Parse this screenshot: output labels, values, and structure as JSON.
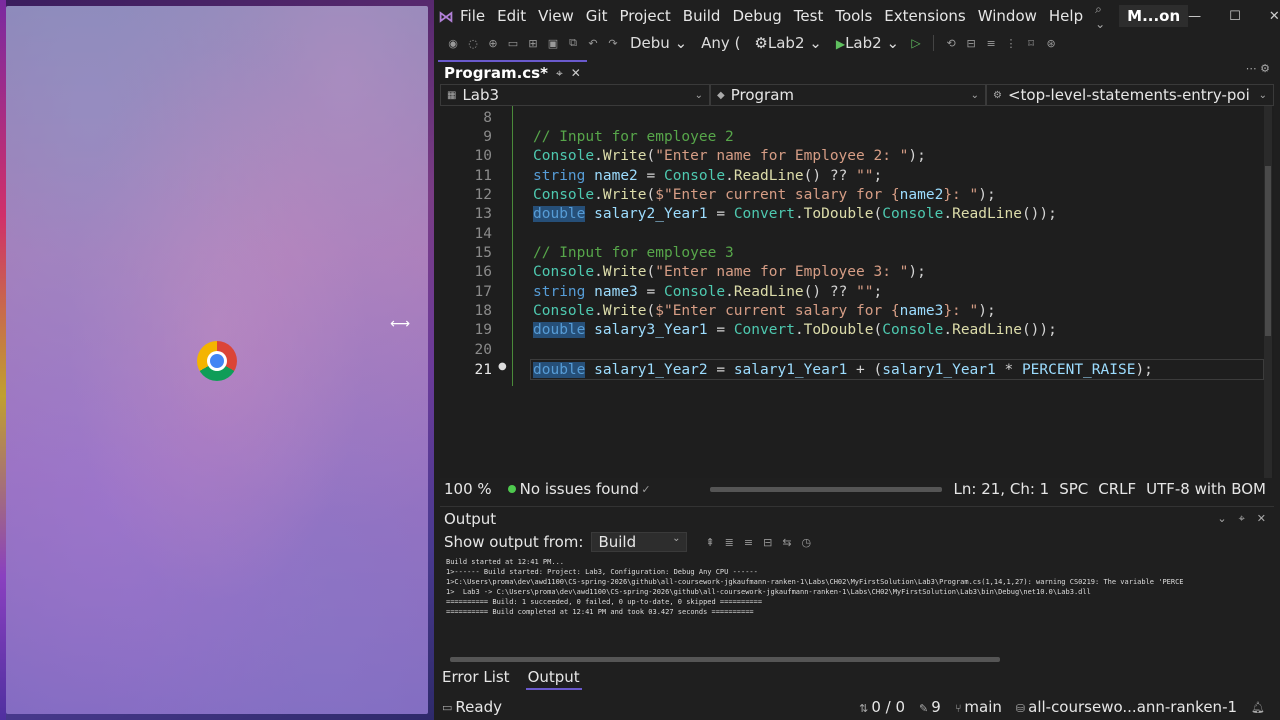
{
  "menubar": {
    "items": [
      "File",
      "Edit",
      "View",
      "Git",
      "Project",
      "Build",
      "Debug",
      "Test",
      "Tools",
      "Extensions",
      "Window",
      "Help"
    ],
    "solution": "M...on"
  },
  "toolbar": {
    "config": "Debu",
    "platform": "Any (",
    "startup_project": "Lab2",
    "run_target": "Lab2"
  },
  "tabs": {
    "active": "Program.cs*"
  },
  "navbar": {
    "project": "Lab3",
    "type": "Program",
    "member": "<top-level-statements-entry-poi"
  },
  "editor": {
    "lines": [
      {
        "n": "8"
      },
      {
        "n": "9"
      },
      {
        "n": "10"
      },
      {
        "n": "11"
      },
      {
        "n": "12"
      },
      {
        "n": "13"
      },
      {
        "n": "14"
      },
      {
        "n": "15"
      },
      {
        "n": "16"
      },
      {
        "n": "17"
      },
      {
        "n": "18"
      },
      {
        "n": "19"
      },
      {
        "n": "20"
      },
      {
        "n": "21"
      }
    ],
    "code": {
      "l9": "// Input for employee 2",
      "l10_a": "Console",
      "l10_b": "Write",
      "l10_s": "\"Enter name for Employee 2: \"",
      "l11_k": "string",
      "l11_v": "name2",
      "l11_a": "Console",
      "l11_b": "ReadLine",
      "l11_s": "\"\"",
      "l12_a": "Console",
      "l12_b": "Write",
      "l12_s1": "$\"Enter current salary for {",
      "l12_v": "name2",
      "l12_s2": "}: \"",
      "l13_k": "double",
      "l13_v": "salary2_Year1",
      "l13_a": "Convert",
      "l13_b": "ToDouble",
      "l13_c": "Console",
      "l13_d": "ReadLine",
      "l15": "// Input for employee 3",
      "l16_a": "Console",
      "l16_b": "Write",
      "l16_s": "\"Enter name for Employee 3: \"",
      "l17_k": "string",
      "l17_v": "name3",
      "l17_a": "Console",
      "l17_b": "ReadLine",
      "l17_s": "\"\"",
      "l18_a": "Console",
      "l18_b": "Write",
      "l18_s1": "$\"Enter current salary for {",
      "l18_v": "name3",
      "l18_s2": "}: \"",
      "l19_k": "double",
      "l19_v": "salary3_Year1",
      "l19_a": "Convert",
      "l19_b": "ToDouble",
      "l19_c": "Console",
      "l19_d": "ReadLine",
      "l21_k": "double",
      "l21_v": "salary1_Year2",
      "l21_a": "salary1_Year1",
      "l21_b": "salary1_Year1",
      "l21_c": "PERCENT_RAISE"
    }
  },
  "status_line": {
    "zoom": "100 %",
    "issues": "No issues found",
    "position": "Ln: 21, Ch: 1",
    "whitespace": "SPC",
    "line_endings": "CRLF",
    "encoding": "UTF-8 with BOM"
  },
  "output": {
    "title": "Output",
    "show_from_label": "Show output from:",
    "source": "Build",
    "text": "Build started at 12:41 PM...\n1>------ Build started: Project: Lab3, Configuration: Debug Any CPU ------\n1>C:\\Users\\proma\\dev\\awd1100\\CS-spring-2026\\github\\all-coursework-jgkaufmann-ranken-1\\Labs\\CH02\\MyFirstSolution\\Lab3\\Program.cs(1,14,1,27): warning CS0219: The variable 'PERCE\n1>  Lab3 -> C:\\Users\\proma\\dev\\awd1100\\CS-spring-2026\\github\\all-coursework-jgkaufmann-ranken-1\\Labs\\CH02\\MyFirstSolution\\Lab3\\bin\\Debug\\net10.0\\Lab3.dll\n========== Build: 1 succeeded, 0 failed, 0 up-to-date, 0 skipped ==========\n========== Build completed at 12:41 PM and took 03.427 seconds =========="
  },
  "bottom_tabs": [
    "Error List",
    "Output"
  ],
  "statusbar": {
    "ready": "Ready",
    "changes": "0 / 0",
    "commits": "9",
    "branch": "main",
    "repo": "all-coursewo...ann-ranken-1"
  },
  "colors": {
    "accent": "#6a5acd",
    "keyword": "#569cd6",
    "comment": "#57a64a",
    "string": "#d69d85"
  }
}
